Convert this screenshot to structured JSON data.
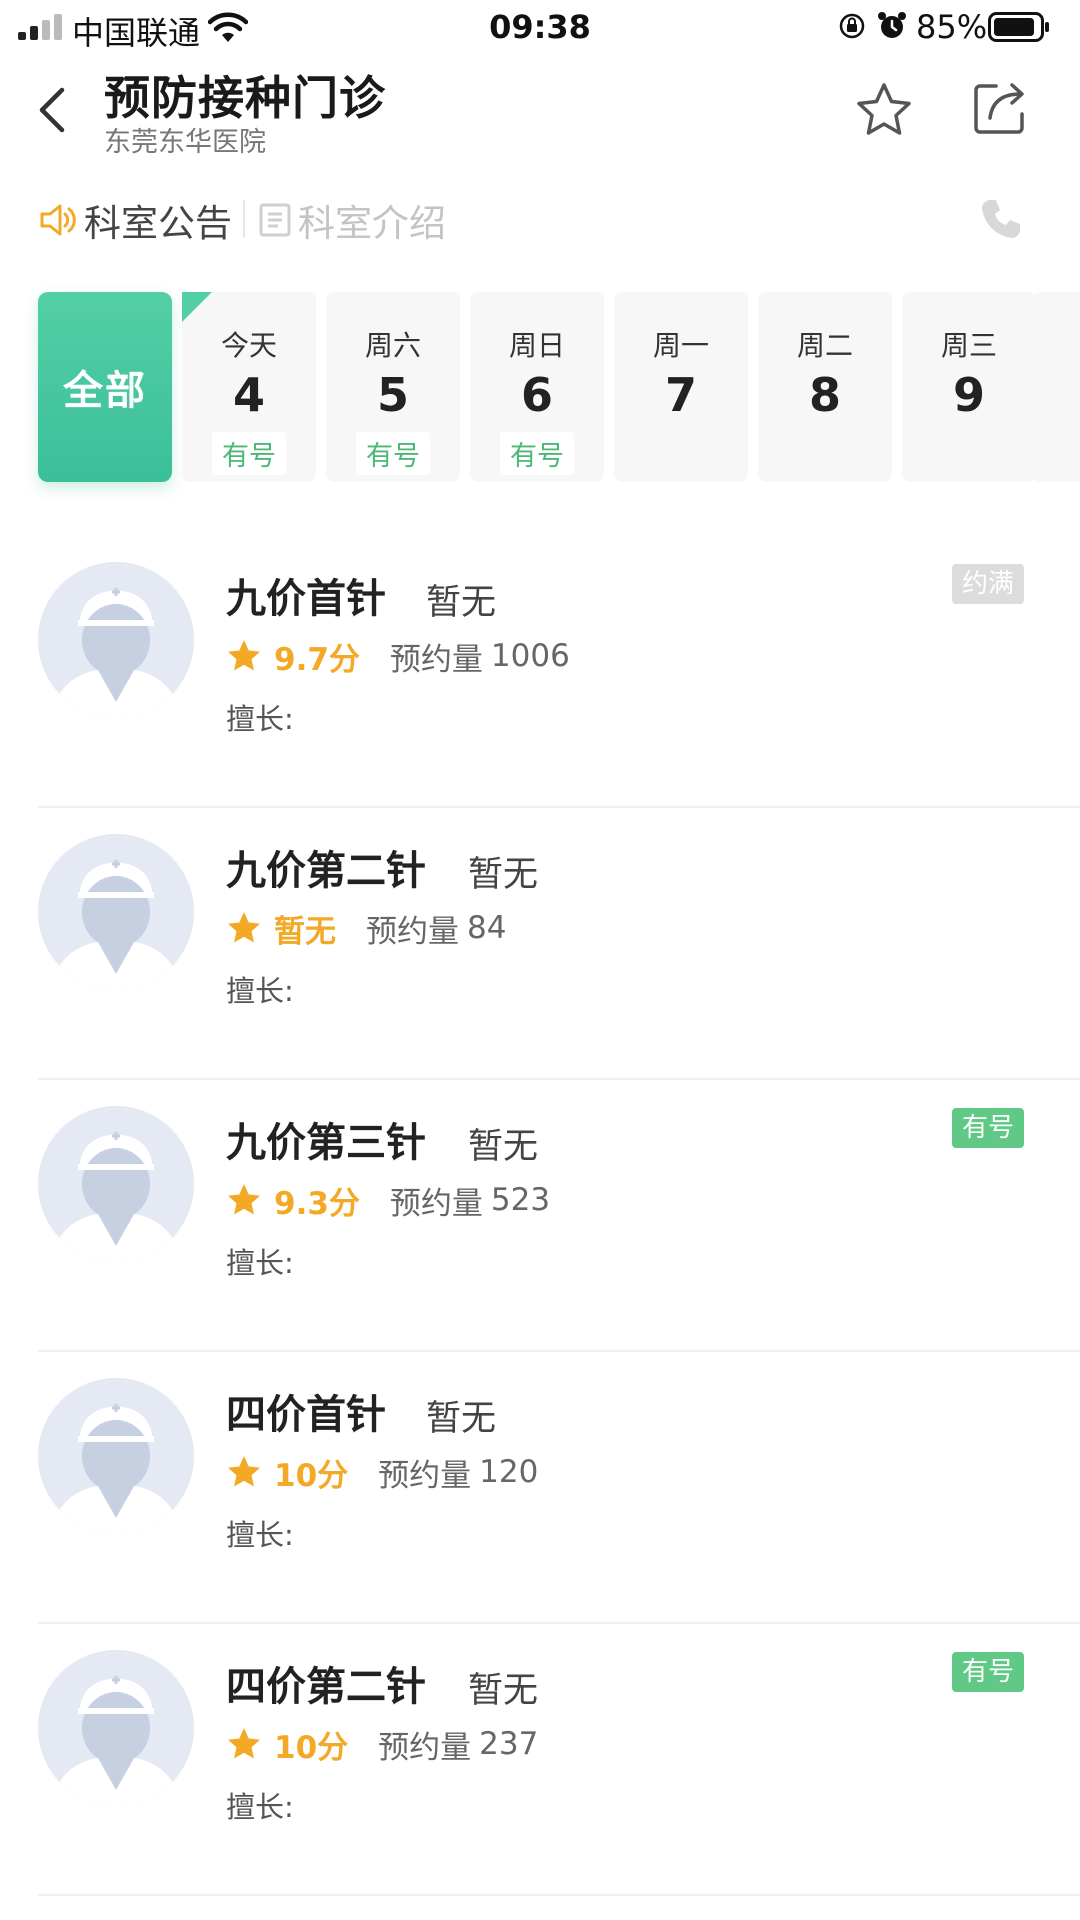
{
  "status_bar": {
    "carrier": "中国联通",
    "time": "09:38",
    "battery": "85%"
  },
  "header": {
    "title": "预防接种门诊",
    "subtitle": "东莞东华医院"
  },
  "tabs": {
    "notice": "科室公告",
    "intro": "科室介绍"
  },
  "dates": {
    "all_label": "全部",
    "days": [
      {
        "weekday": "今天",
        "date": "4",
        "availability": "有号"
      },
      {
        "weekday": "周六",
        "date": "5",
        "availability": "有号"
      },
      {
        "weekday": "周日",
        "date": "6",
        "availability": "有号"
      },
      {
        "weekday": "周一",
        "date": "7",
        "availability": ""
      },
      {
        "weekday": "周二",
        "date": "8",
        "availability": ""
      },
      {
        "weekday": "周三",
        "date": "9",
        "availability": ""
      }
    ]
  },
  "doctors": [
    {
      "name": "九价首针",
      "title": "暂无",
      "score": "9.7分",
      "volume_label": "预约量",
      "volume": "1006",
      "skill": "擅长:",
      "status": "约满"
    },
    {
      "name": "九价第二针",
      "title": "暂无",
      "score": "暂无",
      "volume_label": "预约量",
      "volume": "84",
      "skill": "擅长:",
      "status": ""
    },
    {
      "name": "九价第三针",
      "title": "暂无",
      "score": "9.3分",
      "volume_label": "预约量",
      "volume": "523",
      "skill": "擅长:",
      "status": "有号"
    },
    {
      "name": "四价首针",
      "title": "暂无",
      "score": "10分",
      "volume_label": "预约量",
      "volume": "120",
      "skill": "擅长:",
      "status": ""
    },
    {
      "name": "四价第二针",
      "title": "暂无",
      "score": "10分",
      "volume_label": "预约量",
      "volume": "237",
      "skill": "擅长:",
      "status": "有号"
    }
  ],
  "colors": {
    "accent": "#3bbf9a",
    "available": "#5fc985",
    "full": "#dcdcdc",
    "rating": "#f3a826"
  }
}
